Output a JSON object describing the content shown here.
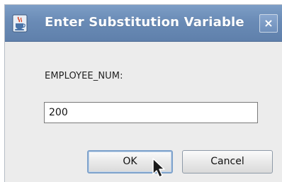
{
  "dialog": {
    "title": "Enter Substitution Variable",
    "close_label": "×",
    "variable_label": "EMPLOYEE_NUM:",
    "input_value": "200",
    "ok_label": "OK",
    "cancel_label": "Cancel"
  },
  "icons": {
    "app": "java-cup-icon",
    "close": "close-icon",
    "pointer": "mouse-cursor-icon"
  },
  "colors": {
    "titlebar": "#6a8bb6",
    "dialog_bg": "#ececec",
    "ok_focus_border": "#7fa3cc"
  }
}
